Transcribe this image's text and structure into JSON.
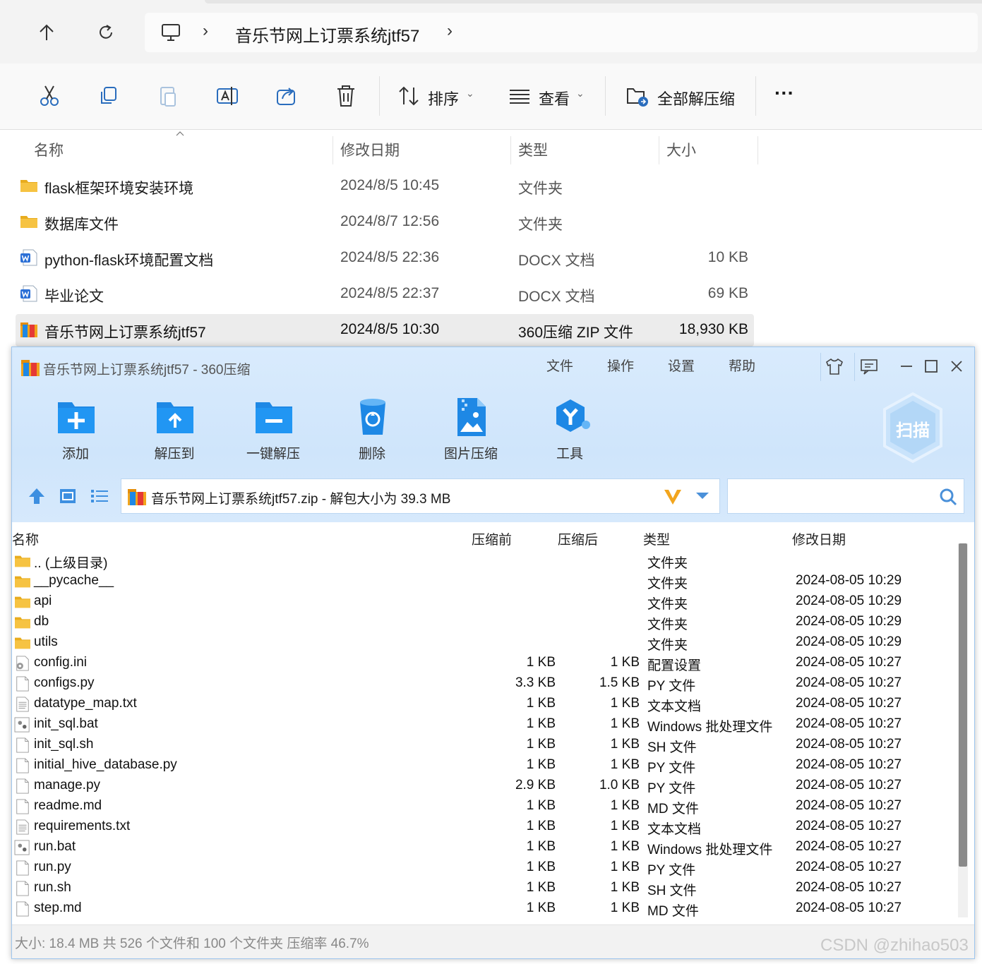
{
  "explorer": {
    "breadcrumb": "音乐节网上订票系统jtf57",
    "toolbar": {
      "sort_label": "排序",
      "view_label": "查看",
      "extract_all_label": "全部解压缩",
      "more_label": "···"
    },
    "columns": {
      "name": "名称",
      "date": "修改日期",
      "type": "类型",
      "size": "大小"
    },
    "files": [
      {
        "name": "flask框架环境安装环境",
        "date": "2024/8/5 10:45",
        "type": "文件夹",
        "size": "",
        "icon": "folder-icon"
      },
      {
        "name": "数据库文件",
        "date": "2024/8/7 12:56",
        "type": "文件夹",
        "size": "",
        "icon": "folder-icon"
      },
      {
        "name": "python-flask环境配置文档",
        "date": "2024/8/5 22:36",
        "type": "DOCX 文档",
        "size": "10 KB",
        "icon": "word-doc-icon"
      },
      {
        "name": "毕业论文",
        "date": "2024/8/5 22:37",
        "type": "DOCX 文档",
        "size": "69 KB",
        "icon": "word-doc-icon"
      },
      {
        "name": "音乐节网上订票系统jtf57",
        "date": "2024/8/5 10:30",
        "type": "360压缩 ZIP 文件",
        "size": "18,930 KB",
        "icon": "zip-archive-icon",
        "selected": true
      }
    ]
  },
  "z360": {
    "title": "音乐节网上订票系统jtf57 - 360压缩",
    "menu": [
      "文件",
      "操作",
      "设置",
      "帮助"
    ],
    "tools": [
      {
        "label": "添加",
        "icon": "add-folder-icon"
      },
      {
        "label": "解压到",
        "icon": "extract-to-icon"
      },
      {
        "label": "一键解压",
        "icon": "one-click-extract-icon"
      },
      {
        "label": "删除",
        "icon": "recycle-bin-icon"
      },
      {
        "label": "图片压缩",
        "icon": "image-compress-icon"
      },
      {
        "label": "工具",
        "icon": "tools-icon"
      }
    ],
    "scan_label": "扫描",
    "path_text": "音乐节网上订票系统jtf57.zip - 解包大小为 39.3 MB",
    "columns": {
      "name": "名称",
      "before": "压缩前",
      "after": "压缩后",
      "type": "类型",
      "date": "修改日期"
    },
    "rows": [
      {
        "name": ".. (上级目录)",
        "before": "",
        "after": "",
        "type": "文件夹",
        "date": "",
        "icon": "folder-icon"
      },
      {
        "name": "__pycache__",
        "before": "",
        "after": "",
        "type": "文件夹",
        "date": "2024-08-05 10:29",
        "icon": "folder-icon"
      },
      {
        "name": "api",
        "before": "",
        "after": "",
        "type": "文件夹",
        "date": "2024-08-05 10:29",
        "icon": "folder-icon"
      },
      {
        "name": "db",
        "before": "",
        "after": "",
        "type": "文件夹",
        "date": "2024-08-05 10:29",
        "icon": "folder-icon"
      },
      {
        "name": "utils",
        "before": "",
        "after": "",
        "type": "文件夹",
        "date": "2024-08-05 10:29",
        "icon": "folder-icon"
      },
      {
        "name": "config.ini",
        "before": "1 KB",
        "after": "1 KB",
        "type": "配置设置",
        "date": "2024-08-05 10:27",
        "icon": "settings-file-icon"
      },
      {
        "name": "configs.py",
        "before": "3.3 KB",
        "after": "1.5 KB",
        "type": "PY 文件",
        "date": "2024-08-05 10:27",
        "icon": "file-icon"
      },
      {
        "name": "datatype_map.txt",
        "before": "1 KB",
        "after": "1 KB",
        "type": "文本文档",
        "date": "2024-08-05 10:27",
        "icon": "text-file-icon"
      },
      {
        "name": "init_sql.bat",
        "before": "1 KB",
        "after": "1 KB",
        "type": "Windows 批处理文件",
        "date": "2024-08-05 10:27",
        "icon": "batch-file-icon"
      },
      {
        "name": "init_sql.sh",
        "before": "1 KB",
        "after": "1 KB",
        "type": "SH 文件",
        "date": "2024-08-05 10:27",
        "icon": "file-icon"
      },
      {
        "name": "initial_hive_database.py",
        "before": "1 KB",
        "after": "1 KB",
        "type": "PY 文件",
        "date": "2024-08-05 10:27",
        "icon": "file-icon"
      },
      {
        "name": "manage.py",
        "before": "2.9 KB",
        "after": "1.0 KB",
        "type": "PY 文件",
        "date": "2024-08-05 10:27",
        "icon": "file-icon"
      },
      {
        "name": "readme.md",
        "before": "1 KB",
        "after": "1 KB",
        "type": "MD 文件",
        "date": "2024-08-05 10:27",
        "icon": "file-icon"
      },
      {
        "name": "requirements.txt",
        "before": "1 KB",
        "after": "1 KB",
        "type": "文本文档",
        "date": "2024-08-05 10:27",
        "icon": "text-file-icon"
      },
      {
        "name": "run.bat",
        "before": "1 KB",
        "after": "1 KB",
        "type": "Windows 批处理文件",
        "date": "2024-08-05 10:27",
        "icon": "batch-file-icon"
      },
      {
        "name": "run.py",
        "before": "1 KB",
        "after": "1 KB",
        "type": "PY 文件",
        "date": "2024-08-05 10:27",
        "icon": "file-icon"
      },
      {
        "name": "run.sh",
        "before": "1 KB",
        "after": "1 KB",
        "type": "SH 文件",
        "date": "2024-08-05 10:27",
        "icon": "file-icon"
      },
      {
        "name": "step.md",
        "before": "1 KB",
        "after": "1 KB",
        "type": "MD 文件",
        "date": "2024-08-05 10:27",
        "icon": "file-icon"
      }
    ],
    "status": "大小: 18.4 MB 共 526 个文件和 100 个文件夹 压缩率 46.7%"
  },
  "watermark": "CSDN @zhihao503",
  "colors": {
    "folder": "#f6c342",
    "word": "#2b6fd6",
    "zip_blue": "#1e88e5",
    "header_bg": "#d6e9fc",
    "accent_orange": "#f2a51d"
  }
}
